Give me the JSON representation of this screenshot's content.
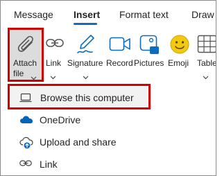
{
  "tabs": [
    {
      "label": "Message"
    },
    {
      "label": "Insert",
      "active": true
    },
    {
      "label": "Format text"
    },
    {
      "label": "Draw"
    }
  ],
  "ribbon": {
    "attach": {
      "line1": "Attach",
      "line2": "file",
      "icon": "paperclip-icon"
    },
    "link": {
      "label": "Link",
      "icon": "link-icon"
    },
    "signature": {
      "label": "Signature",
      "icon": "signature-pen-icon"
    },
    "record": {
      "label": "Record",
      "icon": "video-camera-icon"
    },
    "pictures": {
      "label": "Pictures",
      "icon": "pictures-icon"
    },
    "emoji": {
      "label": "Emoji",
      "icon": "smiley-icon"
    },
    "table": {
      "label": "Table",
      "icon": "table-grid-icon"
    }
  },
  "menu": {
    "items": [
      {
        "label": "Browse this computer",
        "icon": "laptop-icon"
      },
      {
        "label": "OneDrive",
        "icon": "onedrive-cloud-icon"
      },
      {
        "label": "Upload and share",
        "icon": "cloud-upload-icon"
      },
      {
        "label": "Link",
        "icon": "link-icon"
      }
    ]
  },
  "colors": {
    "accent_blue": "#0f6cbd",
    "highlight_red": "#d00000",
    "emoji_yellow": "#f2c811",
    "onedrive_blue": "#0364b8"
  }
}
